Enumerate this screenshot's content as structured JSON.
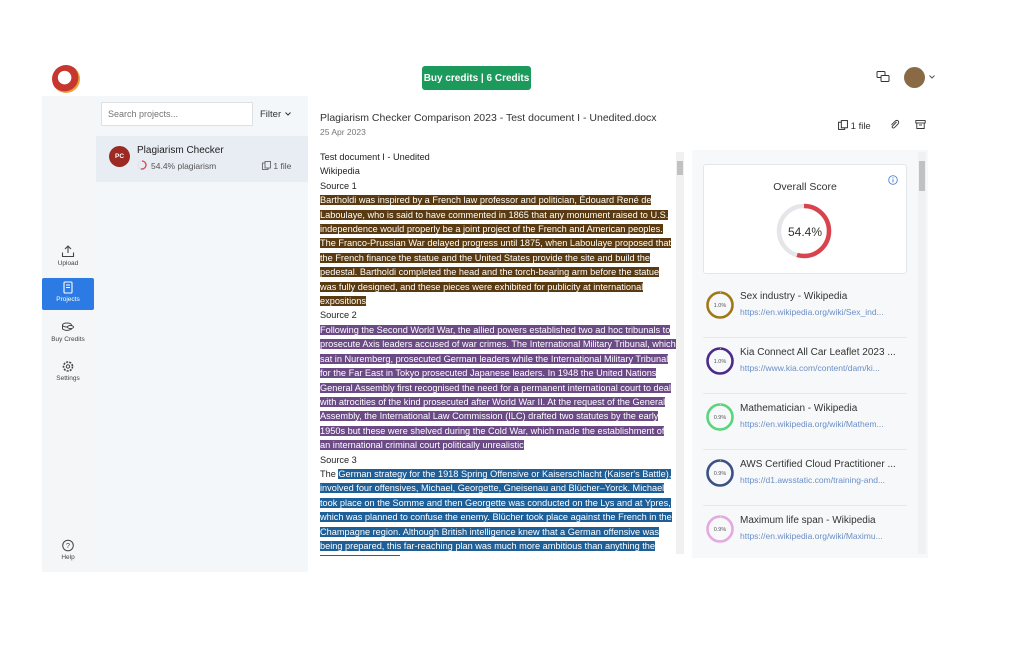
{
  "topbar": {
    "credits_label": "Buy credits | 6 Credits",
    "chat_icon": "chat-bubbles-icon",
    "avatar_icon": "user-avatar"
  },
  "sidebar": {
    "items": [
      {
        "label": "Upload",
        "icon": "upload-icon"
      },
      {
        "label": "Projects",
        "icon": "projects-icon",
        "active": true
      },
      {
        "label": "Buy Credits",
        "icon": "coins-icon"
      },
      {
        "label": "Settings",
        "icon": "gear-icon"
      },
      {
        "label": "Help",
        "icon": "help-icon"
      }
    ]
  },
  "projects": {
    "search_placeholder": "Search projects...",
    "filter_label": "Filter",
    "card": {
      "initials": "PC",
      "name": "Plagiarism Checker",
      "plagiarism": "54.4% plagiarism",
      "files": "1 file"
    }
  },
  "document": {
    "title": "Plagiarism Checker Comparison 2023 - Test document I - Unedited.docx",
    "date": "25 Apr 2023",
    "files_label": "1 file",
    "heading1": "Test document I - Unedited",
    "heading2": "Wikipedia",
    "source1_label": "Source 1",
    "source1_text": "Bartholdi was inspired by a French law professor and politician, Édouard René de Laboulaye, who is said to have commented in 1865 that any monument raised to U.S. independence would properly be a joint project of the French and American peoples. The Franco-Prussian War delayed progress until 1875, when Laboulaye proposed that the French finance the statue and the United States provide the site and build the pedestal. Bartholdi completed the head and the torch-bearing arm before the statue was fully designed, and these pieces were exhibited for publicity at international expositions",
    "source2_label": "Source 2",
    "source2_text": "Following the Second World War, the allied powers established two ad hoc tribunals to prosecute Axis leaders accused of war crimes. The International Military Tribunal, which sat in Nuremberg, prosecuted German leaders while the International Military Tribunal for the Far East in Tokyo prosecuted Japanese leaders. In 1948 the United Nations General Assembly first recognised the need for a permanent international court to deal with atrocities of the kind prosecuted after World War II. At the request of the General Assembly, the International Law Commission (ILC) drafted two statutes by the early 1950s but these were shelved during the Cold War, which made the establishment of an international criminal court politically unrealistic",
    "source3_label": "Source 3",
    "source3_prefix": "The ",
    "source3_text": "German strategy for the 1918 Spring Offensive or Kaiserschlacht (Kaiser's Battle), involved four offensives, Michael, Georgette, Gneisenau and Blücher–Yorck. Michael took place on the Somme and then Georgette was conducted on the Lys and at Ypres, which was planned to confuse the enemy. Blücher took place against the French in the Champagne region. Although British intelligence knew that a German offensive was being prepared, this far-reaching plan was much more ambitious than anything the Allies had expected",
    "highlight_colors": [
      "#5a3a10",
      "#6b4a86",
      "#1f5f97"
    ]
  },
  "results": {
    "overall_title": "Overall Score",
    "overall_value": "54.4%",
    "overall_fraction": 0.544,
    "sources": [
      {
        "pct": "1.0%",
        "fraction": 0.01,
        "color": "#a07818",
        "title": "Sex industry - Wikipedia",
        "url": "https://en.wikipedia.org/wiki/Sex_ind..."
      },
      {
        "pct": "1.0%",
        "fraction": 0.01,
        "color": "#4b2a8a",
        "title": "Kia Connect All Car Leaflet 2023 ...",
        "url": "https://www.kia.com/content/dam/ki..."
      },
      {
        "pct": "0.9%",
        "fraction": 0.009,
        "color": "#5bd47c",
        "title": "Mathematician - Wikipedia",
        "url": "https://en.wikipedia.org/wiki/Mathem..."
      },
      {
        "pct": "0.9%",
        "fraction": 0.009,
        "color": "#3b5185",
        "title": "AWS Certified Cloud Practitioner ...",
        "url": "https://d1.awsstatic.com/training-and..."
      },
      {
        "pct": "0.9%",
        "fraction": 0.009,
        "color": "#e6a8e0",
        "title": "Maximum life span - Wikipedia",
        "url": "https://en.wikipedia.org/wiki/Maximu..."
      }
    ]
  }
}
